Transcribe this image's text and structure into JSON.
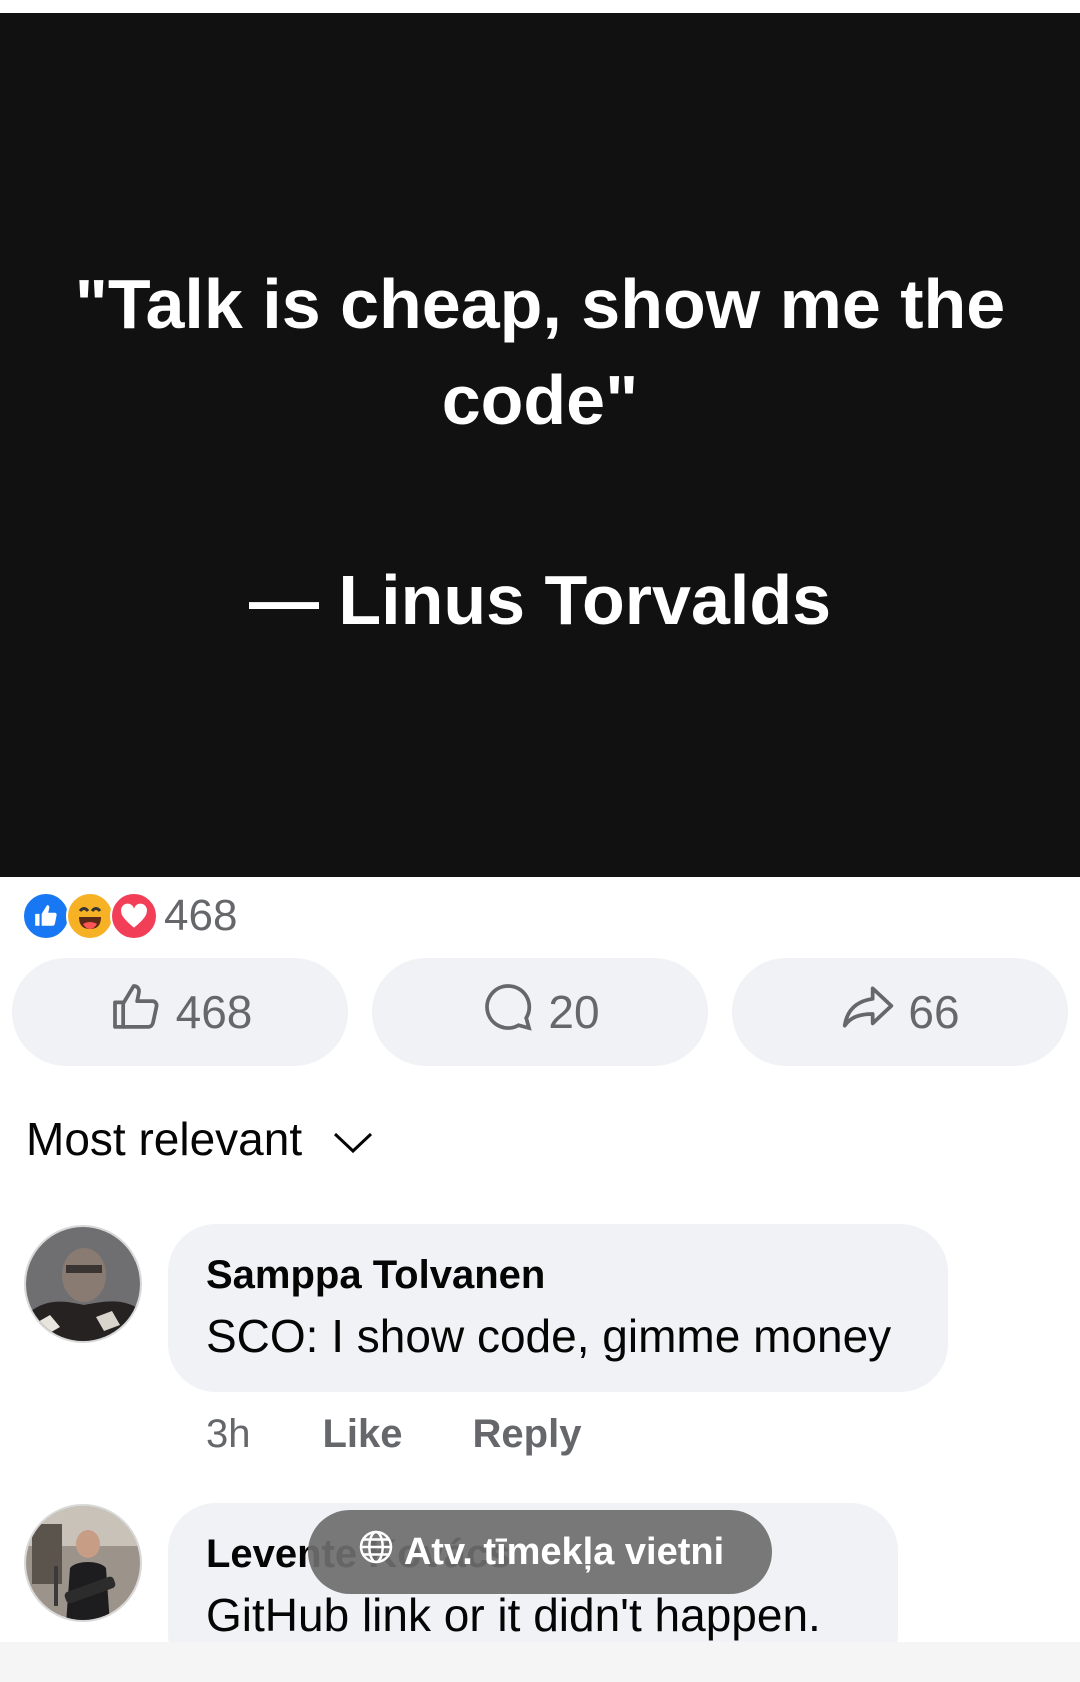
{
  "post": {
    "quote_line1": "\"Talk is cheap, show me the",
    "quote_line2": "code\"",
    "author": "— Linus Torvalds"
  },
  "reactions": {
    "types": [
      "like",
      "haha",
      "love"
    ],
    "total": "468"
  },
  "actions": {
    "like_count": "468",
    "comment_count": "20",
    "share_count": "66"
  },
  "sort": {
    "label": "Most relevant"
  },
  "comments": [
    {
      "author": "Samppa Tolvanen",
      "text": "SCO: I show code, gimme money",
      "time": "3h",
      "like_label": "Like",
      "reply_label": "Reply"
    },
    {
      "author": "Levente Kovács",
      "text": "GitHub link or it didn't happen."
    }
  ],
  "toast": {
    "label": "Atv. tīmekļa vietni",
    "icon": "globe-icon"
  },
  "colors": {
    "image_bg": "#111111",
    "like_blue": "#1877f2",
    "haha_yellow": "#f7b125",
    "love_red": "#f33e58",
    "button_bg": "#f0f2f5",
    "secondary_text": "#65676b"
  }
}
